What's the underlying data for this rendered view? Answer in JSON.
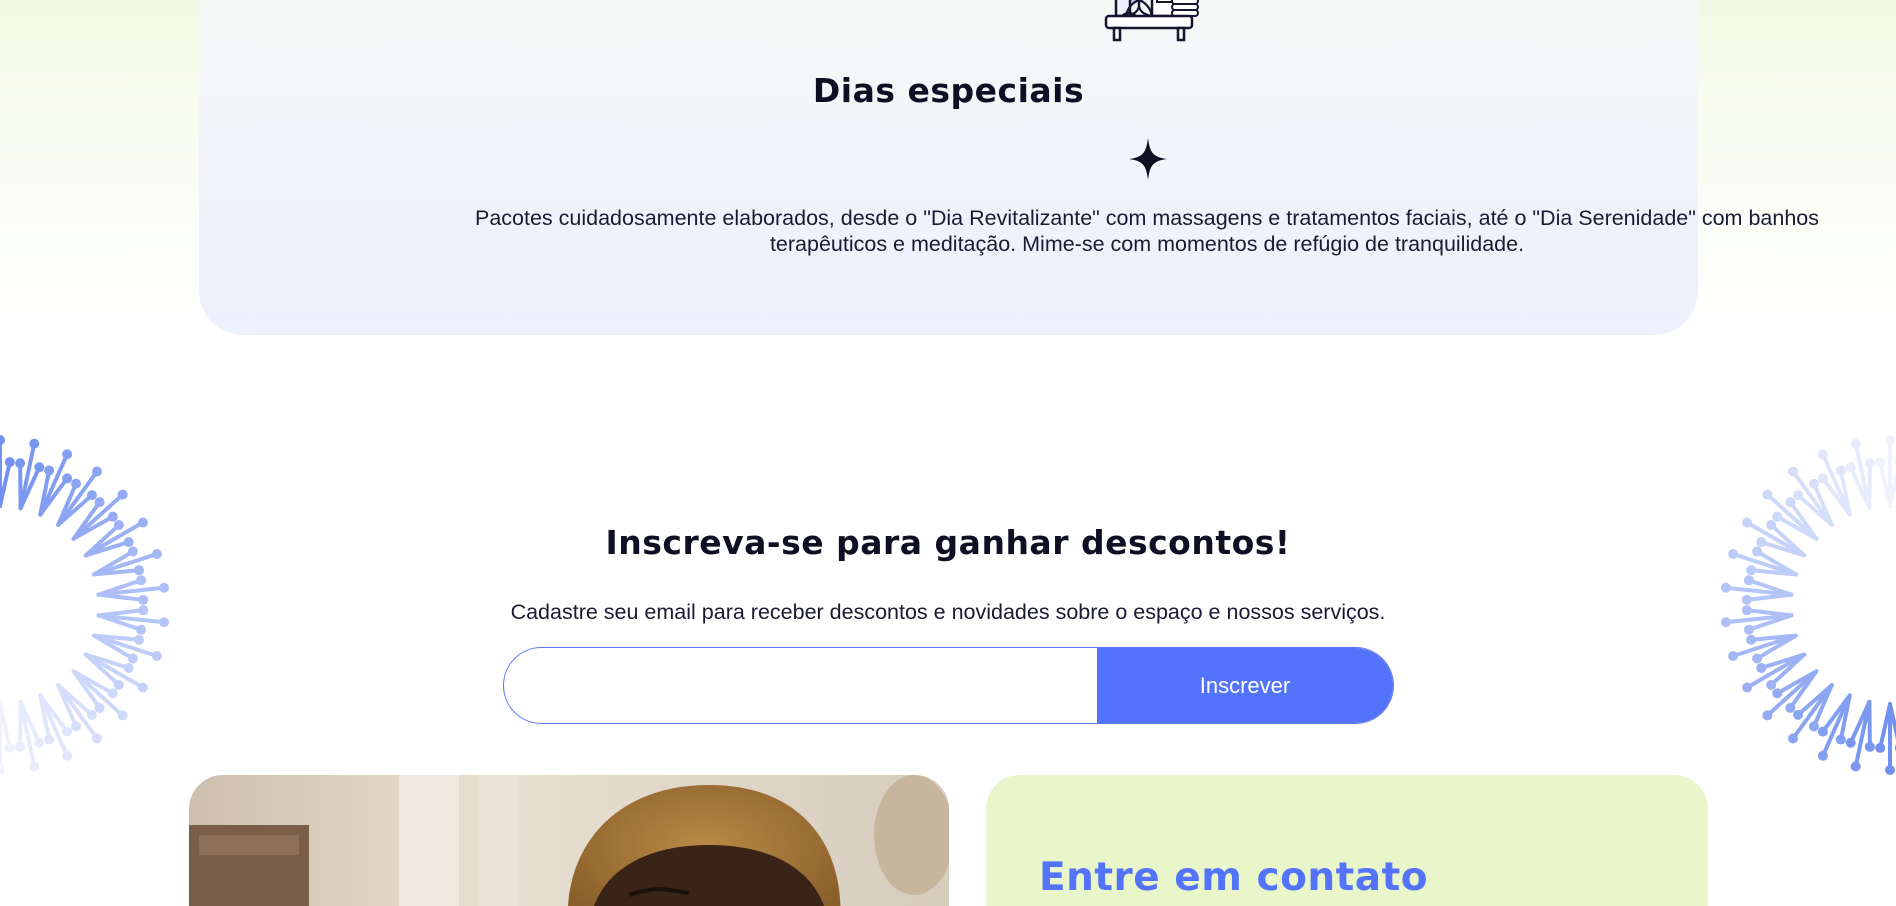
{
  "special": {
    "icon": "spa-candles-icon",
    "title": "Dias especiais",
    "sparkle_icon": "sparkle-icon",
    "description": "Pacotes cuidadosamente elaborados, desde o \"Dia Revitalizante\" com massagens e tratamentos faciais, até o \"Dia Serenidade\" com banhos terapêuticos e meditação. Mime-se com momentos de refúgio de tranquilidade."
  },
  "subscribe": {
    "title": "Inscreva-se para ganhar descontos!",
    "description": "Cadastre seu email para receber descontos e novidades sobre o espaço e nossos serviços.",
    "email_value": "",
    "email_placeholder": "",
    "button_label": "Inscrever"
  },
  "contact": {
    "title": "Entre em contato"
  },
  "decor": {
    "left_icon": "dandelion-left-icon",
    "right_icon": "dandelion-right-icon"
  },
  "colors": {
    "accent": "#5473fb",
    "contact_bg": "#e8f6c9",
    "text": "#0f0f24"
  }
}
